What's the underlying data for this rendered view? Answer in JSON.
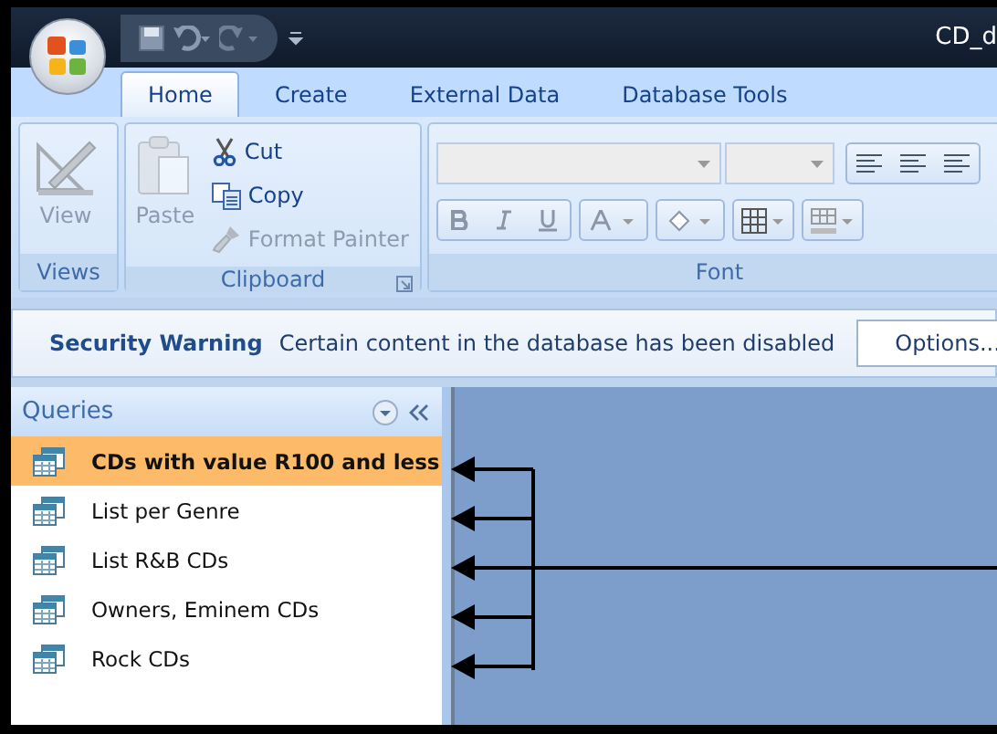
{
  "window": {
    "title": "CD_d"
  },
  "tabs": [
    {
      "label": "Home",
      "selected": true
    },
    {
      "label": "Create",
      "selected": false
    },
    {
      "label": "External Data",
      "selected": false
    },
    {
      "label": "Database Tools",
      "selected": false
    }
  ],
  "ribbon": {
    "views": {
      "label": "Views",
      "view_button": {
        "label": "View",
        "disabled": true
      }
    },
    "clipboard": {
      "label": "Clipboard",
      "paste": {
        "label": "Paste",
        "disabled": true
      },
      "actions": [
        {
          "label": "Cut",
          "kind": "cut",
          "disabled": false
        },
        {
          "label": "Copy",
          "kind": "copy",
          "disabled": false
        },
        {
          "label": "Format Painter",
          "kind": "brush",
          "disabled": true
        }
      ]
    },
    "font": {
      "label": "Font"
    }
  },
  "security_bar": {
    "title": "Security Warning",
    "message": "Certain content in the database has been disabled",
    "button": "Options..."
  },
  "nav_pane": {
    "title": "Queries",
    "items": [
      {
        "label": "CDs with value R100 and less",
        "selected": true
      },
      {
        "label": "List per Genre",
        "selected": false
      },
      {
        "label": "List R&B CDs",
        "selected": false
      },
      {
        "label": "Owners, Eminem CDs",
        "selected": false
      },
      {
        "label": "Rock CDs",
        "selected": false
      }
    ]
  }
}
